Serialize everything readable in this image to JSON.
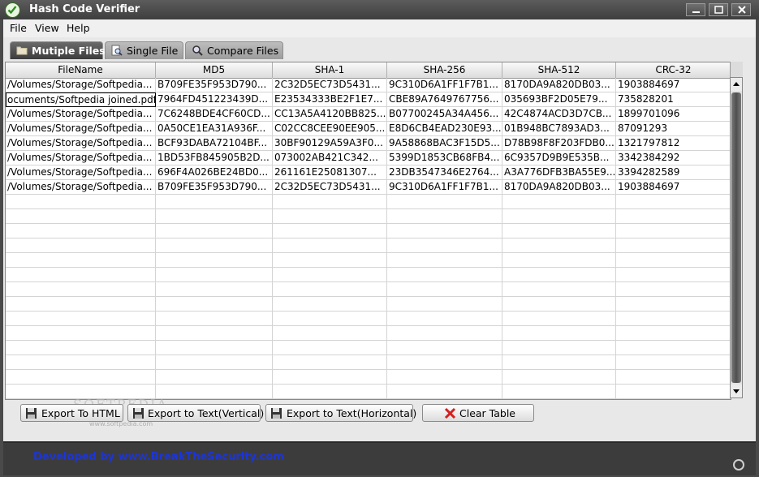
{
  "window": {
    "title": "Hash Code Verifier"
  },
  "menubar": {
    "items": [
      "File",
      "View",
      "Help"
    ]
  },
  "tabs": [
    "Mutiple Files",
    "Single File",
    "Compare Files"
  ],
  "table": {
    "columns": [
      "FileName",
      "MD5",
      "SHA-1",
      "SHA-256",
      "SHA-512",
      "CRC-32"
    ],
    "rows": [
      [
        "/Volumes/Storage/Softpedia...",
        "B709FE35F953D790...",
        "2C32D5EC73D5431...",
        "9C310D6A1FF1F7B1...",
        "8170DA9A820DB03...",
        "1903884697"
      ],
      [
        "ocuments/Softpedia joined.pdf",
        "7964FD451223439D...",
        "E23534333BE2F1E7...",
        "CBE89A7649767756...",
        "035693BF2D05E79...",
        "735828201"
      ],
      [
        "/Volumes/Storage/Softpedia...",
        "7C6248BDE4CF60CD...",
        "CC13A5A4120BB825...",
        "B07700245A34A456...",
        "42C4874ACD3D7CB...",
        "1899701096"
      ],
      [
        "/Volumes/Storage/Softpedia...",
        "0A50CE1EA31A936F...",
        "C02CC8CEE90EE905...",
        "E8D6CB4EAD230E93...",
        "01B948BC7893AD3...",
        "87091293"
      ],
      [
        "/Volumes/Storage/Softpedia...",
        "BCF93DABA72104BF...",
        "30BF90129A59A3F0...",
        "9A58868BAC3F15D5...",
        "D78B98F8F203FDB0...",
        "1321797812"
      ],
      [
        "/Volumes/Storage/Softpedia...",
        "1BD53FB845905B2D...",
        "073002AB421C342...",
        "5399D1853CB68FB4...",
        "6C9357D9B9E535B...",
        "3342384292"
      ],
      [
        "/Volumes/Storage/Softpedia...",
        "696F4A026BE24BD0...",
        "261161E25081307...",
        "23DB3547346E2764...",
        "A3A776DFB3BA55E9...",
        "3394282589"
      ],
      [
        "/Volumes/Storage/Softpedia...",
        "B709FE35F953D790...",
        "2C32D5EC73D5431...",
        "9C310D6A1FF1F7B1...",
        "8170DA9A820DB03...",
        "1903884697"
      ]
    ]
  },
  "buttons": {
    "export_html": "Export To HTML",
    "export_text_vertical": "Export to Text(Vertical)",
    "export_text_horizontal": "Export to Text(Horizontal)",
    "clear_table": "Clear Table"
  },
  "watermark": {
    "logo": "SOFTPEDIA",
    "url": "www.softpedia.com"
  },
  "footer": {
    "credit": "Developed by www.BreakTheSecurity.com"
  },
  "colors": {
    "credit_text": "#1c35d8",
    "active_tab": "#3c3c3c",
    "clear_icon": "#d32020"
  },
  "icons": {
    "app": "green-check-icon",
    "tab_multiple": "folder-icon",
    "tab_single": "magnifier-file-icon",
    "tab_compare": "magnifier-icon",
    "export": "floppy-disk-icon",
    "clear": "red-x-icon"
  }
}
